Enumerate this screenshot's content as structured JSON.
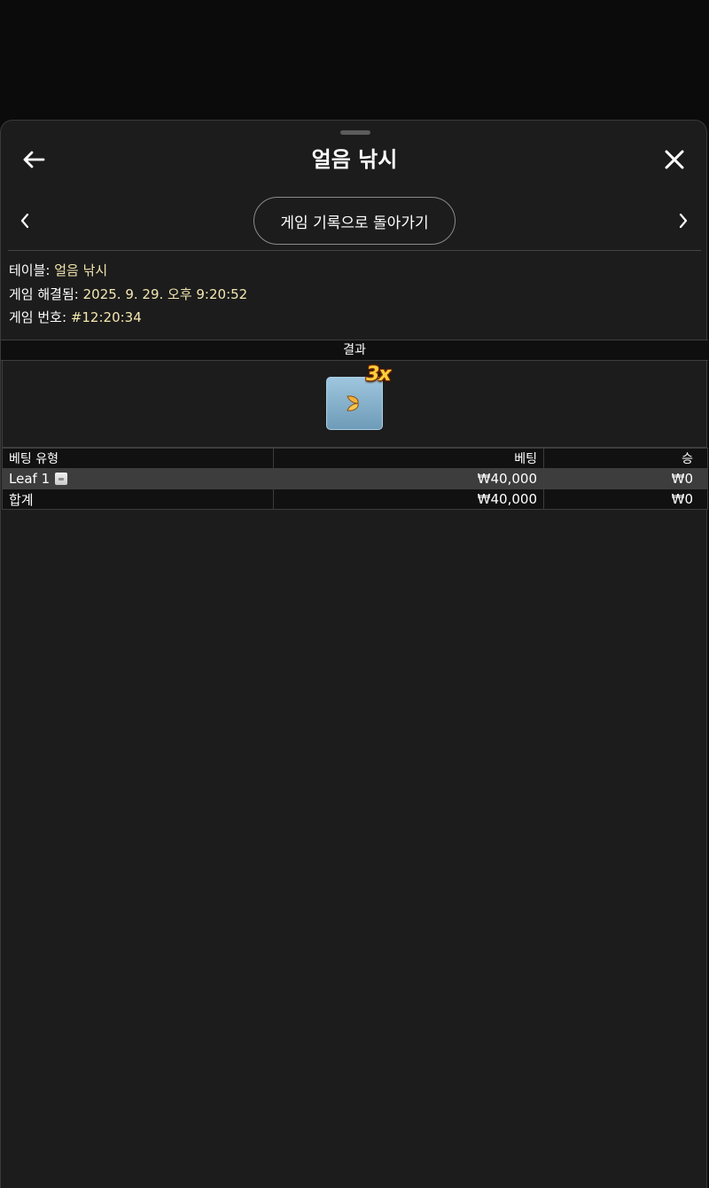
{
  "header": {
    "title": "얼음 낚시"
  },
  "nav": {
    "history_label": "게임 기록으로 돌아가기"
  },
  "info": {
    "table_label": "테이블:",
    "table_value": "얼음 낚시",
    "resolved_label": "게임 해결됨:",
    "resolved_value": "2025. 9. 29. 오후 9:20:52",
    "round_label": "게임 번호:",
    "round_value": "#12:20:34"
  },
  "result": {
    "header": "결과",
    "multiplier": "3x",
    "tile_icon": "leaf-icon"
  },
  "bets": {
    "columns": [
      "베팅 유형",
      "베팅",
      "승"
    ],
    "rows": [
      {
        "type": "Leaf 1",
        "bet": "₩40,000",
        "win": "₩0"
      }
    ],
    "total": {
      "type": "합계",
      "bet": "₩40,000",
      "win": "₩0"
    }
  },
  "colors": {
    "sheet_bg": "#1c1c1c",
    "page_bg": "#0b0b0b",
    "value_text": "#f3e7b0",
    "highlight_row": "#3d3d3d",
    "multiplier": "#ffcf3a",
    "tile": "#8fb8d2"
  }
}
